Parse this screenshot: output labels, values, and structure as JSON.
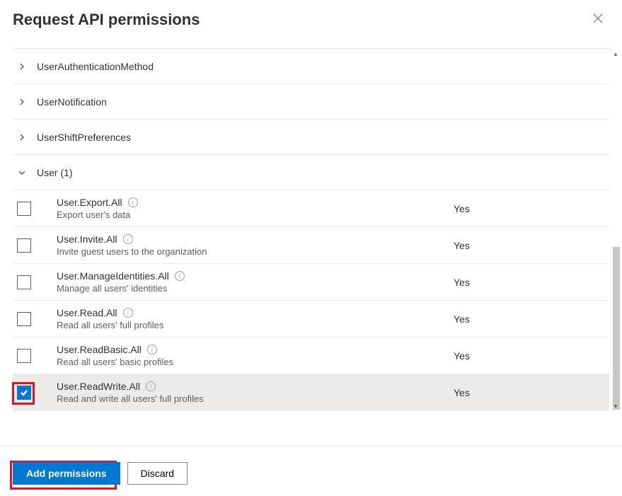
{
  "header": {
    "title": "Request API permissions"
  },
  "groups": [
    {
      "label": "UserAuthenticationMethod",
      "expanded": false
    },
    {
      "label": "UserNotification",
      "expanded": false
    },
    {
      "label": "UserShiftPreferences",
      "expanded": false
    },
    {
      "label": "User (1)",
      "expanded": true
    }
  ],
  "permissions": [
    {
      "name": "User.Export.All",
      "desc": "Export user's data",
      "admin": "Yes",
      "checked": false
    },
    {
      "name": "User.Invite.All",
      "desc": "Invite guest users to the organization",
      "admin": "Yes",
      "checked": false
    },
    {
      "name": "User.ManageIdentities.All",
      "desc": "Manage all users' identities",
      "admin": "Yes",
      "checked": false
    },
    {
      "name": "User.Read.All",
      "desc": "Read all users' full profiles",
      "admin": "Yes",
      "checked": false
    },
    {
      "name": "User.ReadBasic.All",
      "desc": "Read all users' basic profiles",
      "admin": "Yes",
      "checked": false
    },
    {
      "name": "User.ReadWrite.All",
      "desc": "Read and write all users' full profiles",
      "admin": "Yes",
      "checked": true
    }
  ],
  "footer": {
    "add_label": "Add permissions",
    "discard_label": "Discard"
  }
}
